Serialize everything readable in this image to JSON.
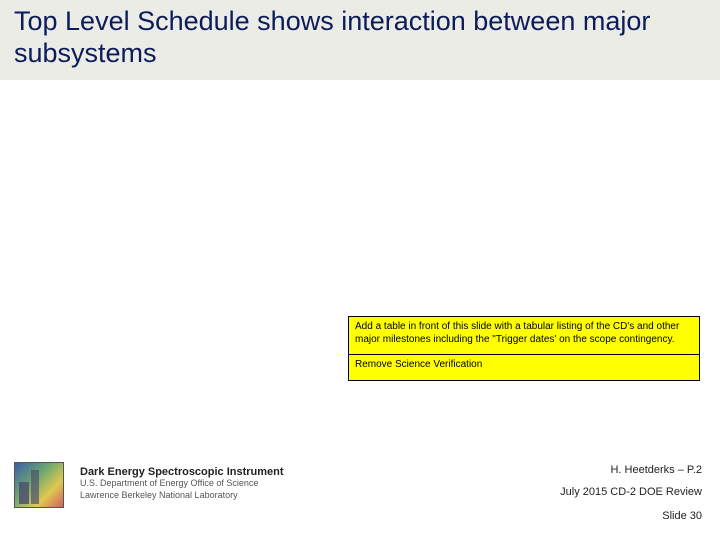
{
  "header": {
    "title": "Top Level Schedule shows interaction between major subsystems"
  },
  "notes": {
    "line1": "Add a table in front of this slide with a tabular listing of the CD's and other major milestones including the \"Trigger dates' on the scope contingency.",
    "line2": "Remove Science Verification"
  },
  "footer": {
    "instrument_title": "Dark Energy Spectroscopic Instrument",
    "instrument_sub1": "U.S. Department of Energy Office of Science",
    "instrument_sub2": "Lawrence Berkeley National Laboratory",
    "author": "H. Heetderks – P.2",
    "review": "July 2015 CD-2 DOE Review",
    "slide_label": "Slide 30"
  }
}
